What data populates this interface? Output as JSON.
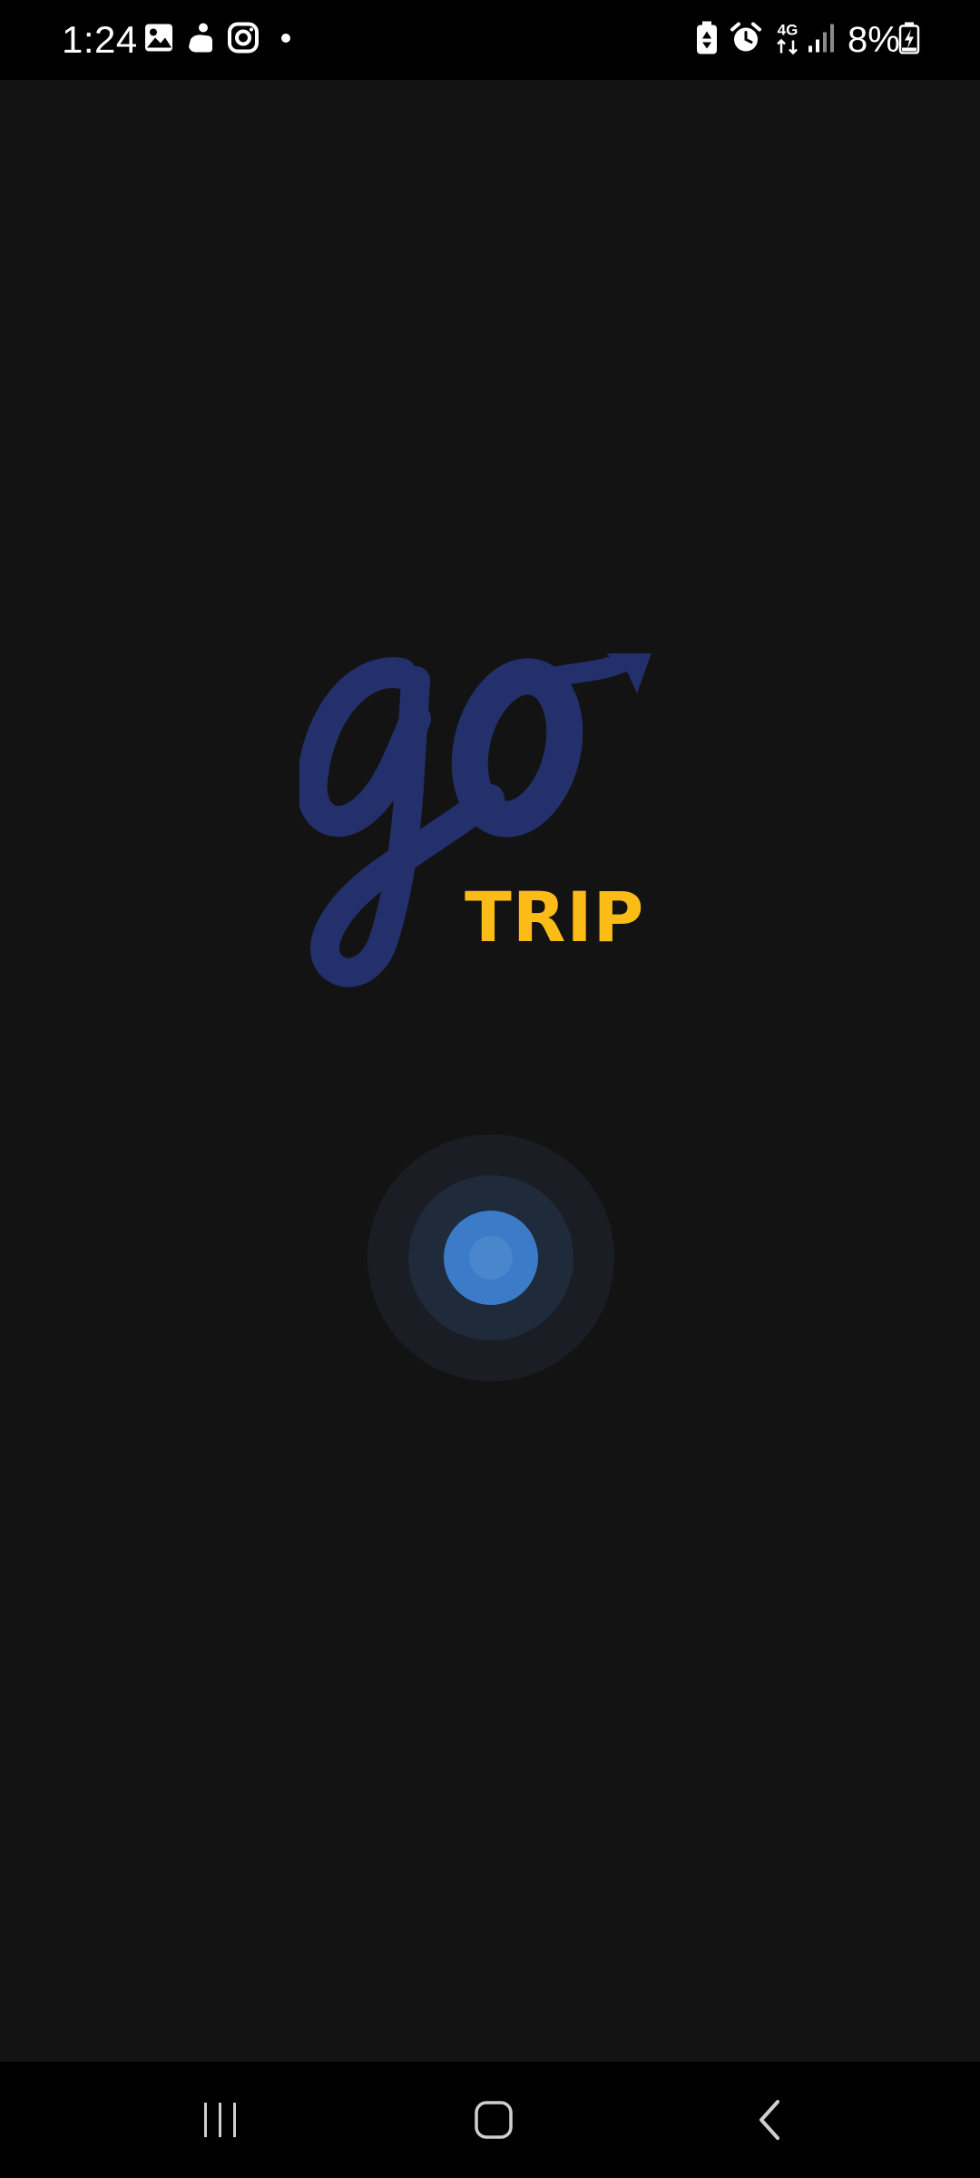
{
  "status_bar": {
    "time": "1:24",
    "battery_percent": "8%",
    "network_label": "4G",
    "notification_icons": [
      "gallery-icon",
      "hand-notification-icon",
      "instagram-icon",
      "more-notifications-dot-icon"
    ],
    "system_icons": [
      "battery-saver-icon",
      "alarm-icon",
      "4g-data-icon",
      "signal-icon",
      "battery-charging-icon"
    ]
  },
  "splash": {
    "logo_script_text": "go",
    "logo_tagline": "TRIP",
    "logo_colors": {
      "script": "#23306b",
      "tagline": "#fbbc18"
    },
    "loader_color": "#3b7bc8"
  },
  "navigation_bar": {
    "items": [
      "recent-apps-icon",
      "home-icon",
      "back-icon"
    ]
  }
}
